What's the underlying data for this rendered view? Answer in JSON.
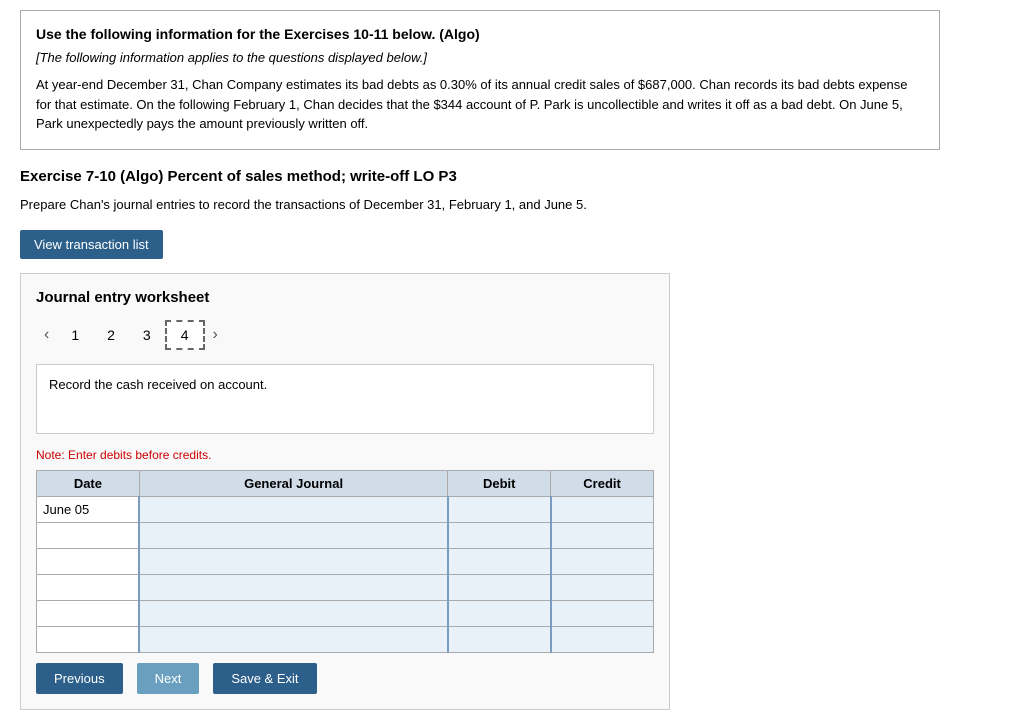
{
  "info_box": {
    "title": "Use the following information for the Exercises 10-11 below. (Algo)",
    "subtitle": "[The following information applies to the questions displayed below.]",
    "body": "At year-end December 31, Chan Company estimates its bad debts as 0.30% of its annual credit sales of $687,000. Chan records its bad debts expense for that estimate. On the following February 1, Chan decides that the $344 account of P. Park is uncollectible and writes it off as a bad debt. On June 5, Park unexpectedly pays the amount previously written off."
  },
  "exercise": {
    "title": "Exercise 7-10 (Algo) Percent of sales method; write-off LO P3",
    "prepare_text": "Prepare Chan's journal entries to record the transactions of December 31, February 1, and June 5.",
    "view_transaction_btn": "View transaction list"
  },
  "worksheet": {
    "title": "Journal entry worksheet",
    "tabs": [
      {
        "label": "1"
      },
      {
        "label": "2"
      },
      {
        "label": "3"
      },
      {
        "label": "4"
      }
    ],
    "active_tab": 3,
    "instruction": "Record the cash received on account.",
    "note": "Note: Enter debits before credits.",
    "table": {
      "headers": [
        "Date",
        "General Journal",
        "Debit",
        "Credit"
      ],
      "rows": [
        {
          "date": "June 05",
          "journal": "",
          "debit": "",
          "credit": ""
        },
        {
          "date": "",
          "journal": "",
          "debit": "",
          "credit": ""
        },
        {
          "date": "",
          "journal": "",
          "debit": "",
          "credit": ""
        },
        {
          "date": "",
          "journal": "",
          "debit": "",
          "credit": ""
        },
        {
          "date": "",
          "journal": "",
          "debit": "",
          "credit": ""
        },
        {
          "date": "",
          "journal": "",
          "debit": "",
          "credit": ""
        }
      ]
    },
    "buttons": {
      "btn1": "Previous",
      "btn2": "Next",
      "btn3": "Save & Exit"
    },
    "nav": {
      "prev": "‹",
      "next": "›"
    }
  }
}
